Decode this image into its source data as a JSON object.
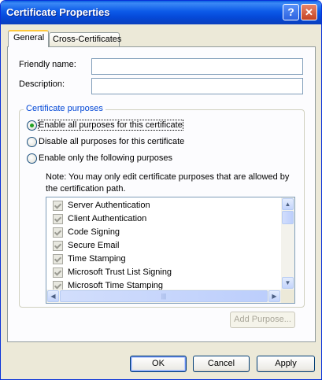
{
  "window": {
    "title": "Certificate Properties",
    "help_glyph": "?",
    "close_glyph": "✕"
  },
  "tabs": [
    {
      "label": "General",
      "selected": true
    },
    {
      "label": "Cross-Certificates",
      "selected": false
    }
  ],
  "form": {
    "friendly_name": {
      "label": "Friendly name:",
      "value": ""
    },
    "description": {
      "label": "Description:",
      "value": ""
    }
  },
  "purposes": {
    "group_title": "Certificate purposes",
    "options": [
      {
        "label": "Enable all purposes for this certificate",
        "checked": true
      },
      {
        "label": "Disable all purposes for this certificate",
        "checked": false
      },
      {
        "label": "Enable only the following purposes",
        "checked": false
      }
    ],
    "note": "Note: You may only edit certificate purposes that are allowed by the certification path.",
    "items": [
      "Server Authentication",
      "Client Authentication",
      "Code Signing",
      "Secure Email",
      "Time Stamping",
      "Microsoft Trust List Signing",
      "Microsoft Time Stamping"
    ],
    "add_button": "Add Purpose..."
  },
  "buttons": {
    "ok": "OK",
    "cancel": "Cancel",
    "apply": "Apply"
  },
  "scroll_glyphs": {
    "up": "▲",
    "down": "▼",
    "left": "◀",
    "right": "▶",
    "grip": "|||"
  },
  "colors": {
    "title_bar": "#0a5fe0",
    "group_title": "#0046d5",
    "dialog_bg": "#ece9d8",
    "radio_dot": "#21a121"
  }
}
